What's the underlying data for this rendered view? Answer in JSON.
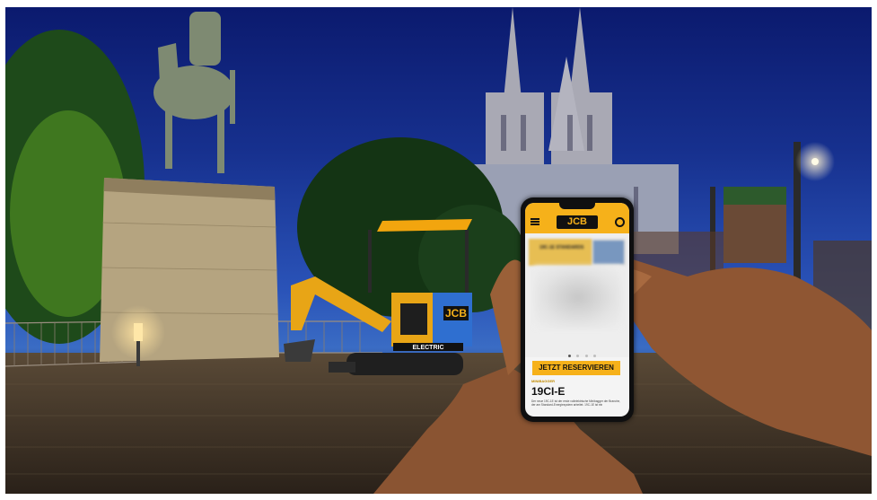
{
  "photo": {
    "subject": "JCB electric mini excavator in front of cathedral at night, hand holding smartphone",
    "excavator": {
      "logo_text": "JCB",
      "badge_text": "ELECTRIC"
    },
    "phone": {
      "brand_logo": "JCB",
      "banner_text": "19C-1E STANDARDS",
      "carousel": {
        "total": 4,
        "active": 1
      },
      "cta_button": "JETZT RESERVIEREN",
      "product_eyebrow": "MINIBAGGER",
      "product_title": "19CI-E",
      "product_description": "Der neue 19C-1E ist der erste vollelektrische Minibagger der Branche, der am Standard-Energiesystem arbeitet. 19C-1E ist ein"
    },
    "colors": {
      "jcb_yellow": "#f6b11a",
      "night_sky": "#1a2f8c",
      "lamp_glow": "#ffd98a"
    }
  }
}
